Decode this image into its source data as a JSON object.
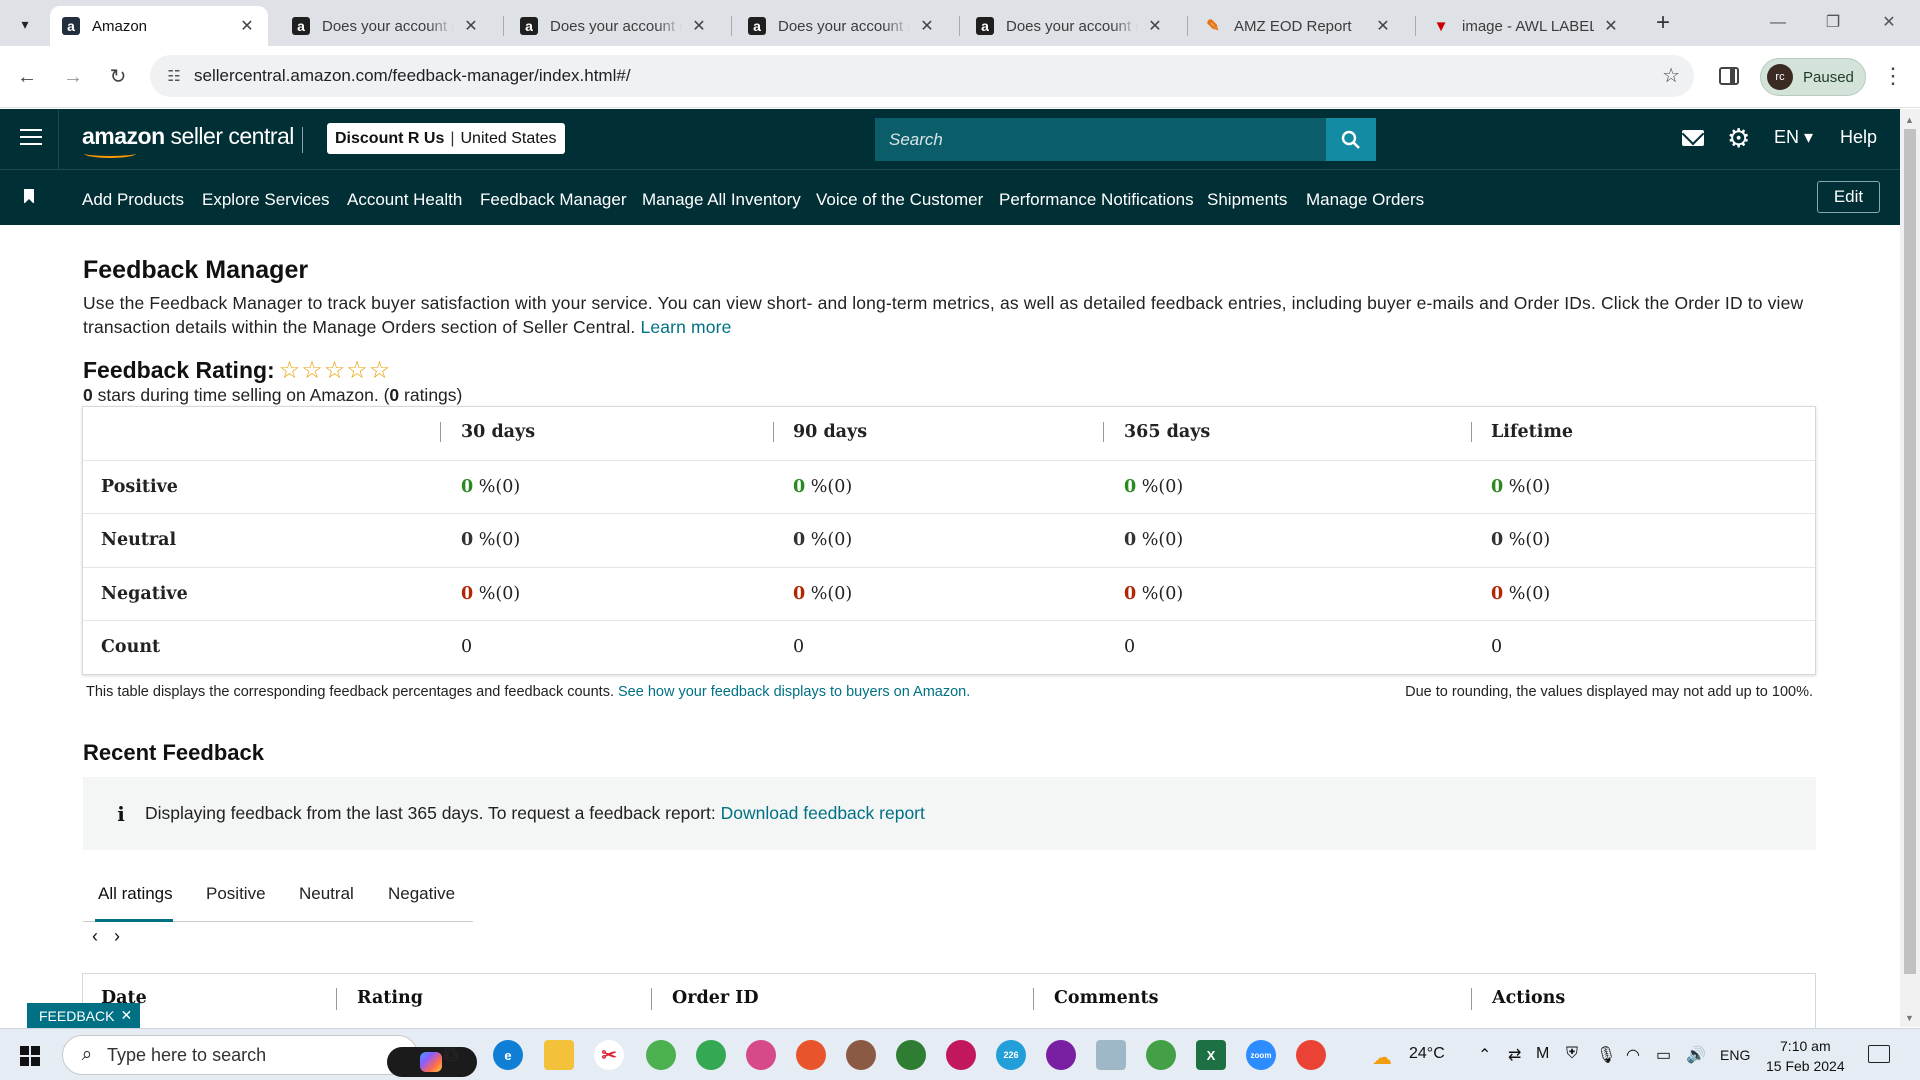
{
  "browser": {
    "tabs": [
      {
        "title": "Amazon",
        "active": true
      },
      {
        "title": "Does your account q"
      },
      {
        "title": "Does your account q"
      },
      {
        "title": "Does your account q"
      },
      {
        "title": "Does your account q"
      },
      {
        "title": "AMZ EOD Report"
      },
      {
        "title": "image - AWL LABEL"
      }
    ],
    "url": "sellercentral.amazon.com/feedback-manager/index.html#/",
    "profile_initials": "rc",
    "profile_status": "Paused"
  },
  "header": {
    "logo_bold": "amazon",
    "logo_rest": " seller central",
    "store_name": "Discount R Us",
    "marketplace": "United States",
    "store_separator": "|",
    "search_placeholder": "Search",
    "language": "EN",
    "help": "Help"
  },
  "nav": {
    "links": [
      "Add Products",
      "Explore Services",
      "Account Health",
      "Feedback Manager",
      "Manage All Inventory",
      "Voice of the Customer",
      "Performance Notifications",
      "Shipments",
      "Manage Orders"
    ],
    "edit": "Edit"
  },
  "page": {
    "title": "Feedback Manager",
    "intro": "Use the Feedback Manager to track buyer satisfaction with your service. You can view short- and long-term metrics, as well as detailed feedback entries, including buyer e-mails and Order IDs. Click the Order ID to view transaction details within the Manage Orders section of Seller Central.",
    "learn_more": "Learn more",
    "rating_label": "Feedback Rating:",
    "rating_stars": "☆☆☆☆☆",
    "rating_stars_value": 0,
    "stars_count": "0",
    "stars_text_mid": " stars during time selling on Amazon. (",
    "ratings_count": "0",
    "stars_text_end": " ratings)"
  },
  "feedback_table": {
    "columns": [
      "30 days",
      "90 days",
      "365 days",
      "Lifetime"
    ],
    "rows": [
      {
        "label": "Positive",
        "kind": "pos",
        "cells": [
          {
            "n": "0",
            "rest": " %(0)"
          },
          {
            "n": "0",
            "rest": " %(0)"
          },
          {
            "n": "0",
            "rest": " %(0)"
          },
          {
            "n": "0",
            "rest": " %(0)"
          }
        ]
      },
      {
        "label": "Neutral",
        "kind": "neu",
        "cells": [
          {
            "n": "0",
            "rest": " %(0)"
          },
          {
            "n": "0",
            "rest": " %(0)"
          },
          {
            "n": "0",
            "rest": " %(0)"
          },
          {
            "n": "0",
            "rest": " %(0)"
          }
        ]
      },
      {
        "label": "Negative",
        "kind": "neg",
        "cells": [
          {
            "n": "0",
            "rest": " %(0)"
          },
          {
            "n": "0",
            "rest": " %(0)"
          },
          {
            "n": "0",
            "rest": " %(0)"
          },
          {
            "n": "0",
            "rest": " %(0)"
          }
        ]
      },
      {
        "label": "Count",
        "kind": "count",
        "cells": [
          {
            "n": "",
            "rest": "0"
          },
          {
            "n": "",
            "rest": "0"
          },
          {
            "n": "",
            "rest": "0"
          },
          {
            "n": "",
            "rest": "0"
          }
        ]
      }
    ],
    "footnote": "This table displays the corresponding feedback percentages and feedback counts.",
    "footnote_link": "See how your feedback displays to buyers on Amazon.",
    "rounding_note": "Due to rounding, the values displayed may not add up to 100%."
  },
  "recent": {
    "title": "Recent Feedback",
    "info_icon": "i",
    "info": "Displaying feedback from the last 365 days. To request a feedback report:",
    "info_link": "Download feedback report",
    "tabs": [
      "All ratings",
      "Positive",
      "Neutral",
      "Negative"
    ],
    "pager_prev": "‹",
    "pager_next": "›",
    "columns": [
      "Date",
      "Rating",
      "Order ID",
      "Comments",
      "Actions"
    ]
  },
  "feedback_tag": {
    "label": "FEEDBACK",
    "close": "✕"
  },
  "taskbar": {
    "search_placeholder": "Type here to search",
    "weather": "24°C",
    "lang": "ENG",
    "time": "7:10 am",
    "date": "15 Feb 2024",
    "telegram_badge": "226"
  },
  "colors": {
    "header_bg": "#002f36",
    "search_btn": "#138ba3",
    "link": "#007185",
    "positive": "#2a8a1f",
    "negative": "#b12704"
  }
}
